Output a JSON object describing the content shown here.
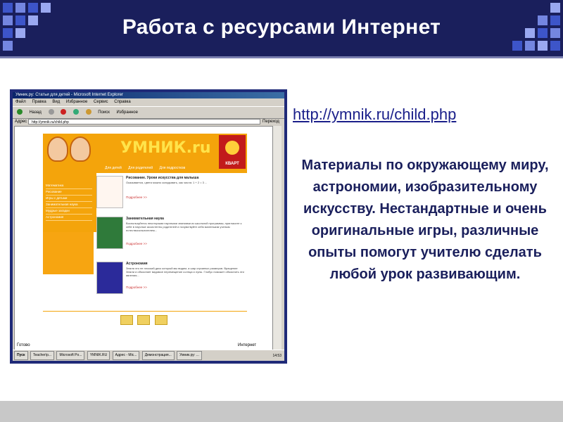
{
  "slide": {
    "title": "Работа с ресурсами Интернет",
    "url": "http://ymnik.ru/child.php",
    "description": "Материалы по окружающему миру, астрономии, изобразительному искусству.  Нестандартные и очень оригинальные игры, различные опыты помогут учителю сделать любой урок развивающим.",
    "colors": {
      "header_bg": "#1a1f5c",
      "accent_text": "#1a1f5c",
      "link": "#1a1f8a",
      "footer_bg": "#c8c8c8",
      "frame": "#1f2a78",
      "site_orange": "#f4a40b"
    }
  },
  "screenshot": {
    "window_title": "Умник.ру: Статьи для детей - Microsoft Internet Explorer",
    "menu": [
      "Файл",
      "Правка",
      "Вид",
      "Избранное",
      "Сервис",
      "Справка"
    ],
    "toolbar": [
      "Назад",
      "Поиск",
      "Избранное"
    ],
    "address_label": "Адрес",
    "address": "http://ymnik.ru/child.php",
    "go_label": "Переход",
    "status_left": "Готово",
    "status_right": "Интернет",
    "taskbar": {
      "start": "Пуск",
      "items": [
        "Teacher\\p...",
        "Microsoft Po...",
        "YMNIK.RU",
        "Адрес - Mic...",
        "Демонстрация...",
        "Умник.ру: ..."
      ],
      "clock": "14:53"
    },
    "site": {
      "logo": "УМНИК.ru",
      "badge": "КВАРТ",
      "nav": [
        "Для детей",
        "Для родителей",
        "Для подростков"
      ],
      "menu": [
        "Математика",
        "Рисование",
        "Игры с детьми",
        "Занимательная наука",
        "Мудрые загадки",
        "Астрономия"
      ],
      "items": [
        {
          "title": "Рисование. Уроки искусства для малыша",
          "desc": "Оказывается, цвета можно складывать, как числа: 1 + 2 = 3 ...",
          "more": "Подробнее >>"
        },
        {
          "title": "Занимательная наука",
          "desc": "Воспользуйтесь некоторыми научными знаниями из школьной программы, пригласите к себе в научные ассистенты родителей и почувствуйте себя маленьким ученым естествоиспытателем...",
          "more": "Подробнее >>"
        },
        {
          "title": "Астрономия",
          "desc": "Земля это не плоский диск который мы видим, а шар огромных размеров. Вращение Земли и объясняет видимое перемещение солнца и луны. Глобус поможет объяснить эти явления...",
          "more": "Подробнее >>"
        }
      ]
    }
  }
}
